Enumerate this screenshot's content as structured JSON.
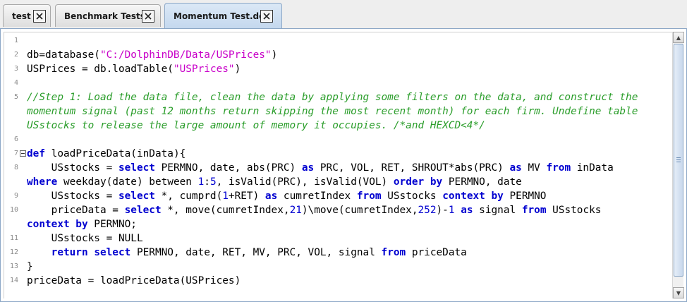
{
  "tabs": [
    {
      "label": "test",
      "active": false
    },
    {
      "label": "Benchmark Tests",
      "active": false
    },
    {
      "label": "Momentum Test.dos",
      "active": true
    }
  ],
  "editor": {
    "line_numbers": [
      "1",
      "2",
      "3",
      "4",
      "5",
      "",
      "",
      "6",
      "7",
      "8",
      "",
      "9",
      "10",
      "",
      "11",
      "12",
      "13",
      "14"
    ],
    "lines": [
      [],
      [
        {
          "t": "db=database(",
          "c": "plain"
        },
        {
          "t": "\"C:/DolphinDB/Data/USPrices\"",
          "c": "str"
        },
        {
          "t": ")",
          "c": "plain"
        }
      ],
      [
        {
          "t": "USPrices = db.loadTable(",
          "c": "plain"
        },
        {
          "t": "\"USPrices\"",
          "c": "str"
        },
        {
          "t": ")",
          "c": "plain"
        }
      ],
      [],
      [
        {
          "t": "//Step 1: Load the data file, clean the data by applying some filters on the data, and construct the",
          "c": "cm"
        }
      ],
      [
        {
          "t": "momentum signal (past 12 months return skipping the most recent month) for each firm. Undefine table",
          "c": "cm"
        }
      ],
      [
        {
          "t": "USstocks to release the large amount of memory it occupies. /*and HEXCD<4*/",
          "c": "cm"
        }
      ],
      [],
      [
        {
          "t": "def",
          "c": "kw"
        },
        {
          "t": " loadPriceData(inData){",
          "c": "plain"
        }
      ],
      [
        {
          "t": "    USstocks = ",
          "c": "plain"
        },
        {
          "t": "select",
          "c": "kw"
        },
        {
          "t": " PERMNO, date, abs(PRC) ",
          "c": "plain"
        },
        {
          "t": "as",
          "c": "kw"
        },
        {
          "t": " PRC, VOL, RET, SHROUT*abs(PRC) ",
          "c": "plain"
        },
        {
          "t": "as",
          "c": "kw"
        },
        {
          "t": " MV ",
          "c": "plain"
        },
        {
          "t": "from",
          "c": "kw"
        },
        {
          "t": " inData",
          "c": "plain"
        }
      ],
      [
        {
          "t": "where",
          "c": "kw"
        },
        {
          "t": " weekday(date) between ",
          "c": "plain"
        },
        {
          "t": "1",
          "c": "num"
        },
        {
          "t": ":",
          "c": "plain"
        },
        {
          "t": "5",
          "c": "num"
        },
        {
          "t": ", isValid(PRC), isValid(VOL) ",
          "c": "plain"
        },
        {
          "t": "order by",
          "c": "kw"
        },
        {
          "t": " PERMNO, date",
          "c": "plain"
        }
      ],
      [
        {
          "t": "    USstocks = ",
          "c": "plain"
        },
        {
          "t": "select",
          "c": "kw"
        },
        {
          "t": " *, cumprd(",
          "c": "plain"
        },
        {
          "t": "1",
          "c": "num"
        },
        {
          "t": "+RET) ",
          "c": "plain"
        },
        {
          "t": "as",
          "c": "kw"
        },
        {
          "t": " cumretIndex ",
          "c": "plain"
        },
        {
          "t": "from",
          "c": "kw"
        },
        {
          "t": " USstocks ",
          "c": "plain"
        },
        {
          "t": "context by",
          "c": "kw"
        },
        {
          "t": " PERMNO",
          "c": "plain"
        }
      ],
      [
        {
          "t": "    priceData = ",
          "c": "plain"
        },
        {
          "t": "select",
          "c": "kw"
        },
        {
          "t": " *, move(cumretIndex,",
          "c": "plain"
        },
        {
          "t": "21",
          "c": "num"
        },
        {
          "t": ")\\move(cumretIndex,",
          "c": "plain"
        },
        {
          "t": "252",
          "c": "num"
        },
        {
          "t": ")-",
          "c": "plain"
        },
        {
          "t": "1",
          "c": "num"
        },
        {
          "t": " ",
          "c": "plain"
        },
        {
          "t": "as",
          "c": "kw"
        },
        {
          "t": " signal ",
          "c": "plain"
        },
        {
          "t": "from",
          "c": "kw"
        },
        {
          "t": " USstocks",
          "c": "plain"
        }
      ],
      [
        {
          "t": "context by",
          "c": "kw"
        },
        {
          "t": " PERMNO;",
          "c": "plain"
        }
      ],
      [
        {
          "t": "    USstocks = NULL",
          "c": "plain"
        }
      ],
      [
        {
          "t": "    ",
          "c": "plain"
        },
        {
          "t": "return",
          "c": "kw"
        },
        {
          "t": " ",
          "c": "plain"
        },
        {
          "t": "select",
          "c": "kw"
        },
        {
          "t": " PERMNO, date, RET, MV, PRC, VOL, signal ",
          "c": "plain"
        },
        {
          "t": "from",
          "c": "kw"
        },
        {
          "t": " priceData",
          "c": "plain"
        }
      ],
      [
        {
          "t": "}",
          "c": "plain"
        }
      ],
      [
        {
          "t": "priceData = loadPriceData(USPrices)",
          "c": "plain"
        }
      ]
    ],
    "fold_line": 8,
    "colors": {
      "keyword": "#0000d0",
      "string": "#c800c8",
      "comment": "#2a9d2a",
      "line_number": "#8c8c8c"
    }
  },
  "scrollbar": {
    "position": 0.0,
    "visible_fraction": 0.95
  }
}
